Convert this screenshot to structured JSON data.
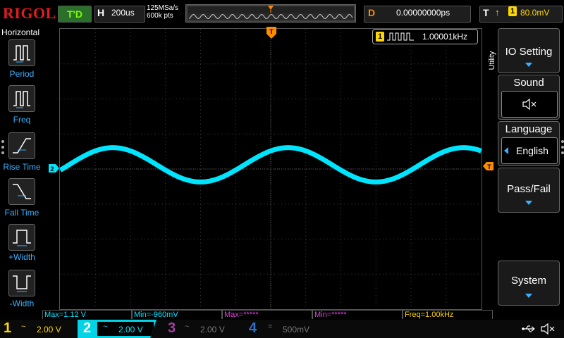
{
  "header": {
    "brand": "RIGOL",
    "run_state": "T'D",
    "horizontal_letter": "H",
    "timebase": "200us",
    "sample_rate": "125MSa/s",
    "memory_depth": "600k pts",
    "delay_letter": "D",
    "delay_value": "0.00000000ps",
    "trigger_letter": "T",
    "trigger_source": "1",
    "trigger_level": "80.0mV"
  },
  "left_panel": {
    "title": "Horizontal",
    "items": [
      {
        "label": "Period"
      },
      {
        "label": "Freq"
      },
      {
        "label": "Rise Time"
      },
      {
        "label": "Fall Time"
      },
      {
        "label": "+Width"
      },
      {
        "label": "-Width"
      }
    ]
  },
  "screen": {
    "channel_marker": "2",
    "trigger_marker": "T",
    "frequency_counter_channel": "1",
    "frequency_counter_value": "1.00001kHz"
  },
  "right_menu": {
    "tab_label": "Utility",
    "io_setting": "IO Setting",
    "sound_title": "Sound",
    "language_title": "Language",
    "language_value": "English",
    "pass_fail": "Pass/Fail",
    "system": "System"
  },
  "measurements": [
    {
      "text": "Max=1.12 V",
      "color": "#00e5ff"
    },
    {
      "text": "Min=-960mV",
      "color": "#00e5ff"
    },
    {
      "text": "Max=*****",
      "color": "#e040e0"
    },
    {
      "text": "Min=*****",
      "color": "#e040e0"
    },
    {
      "text": "Freq=1.00kHz",
      "color": "#ffd700"
    }
  ],
  "channels": [
    {
      "num": "1",
      "coupling": "~",
      "scale": "2.00 V",
      "color": "#ffd700"
    },
    {
      "num": "2",
      "coupling": "~",
      "scale": "2.00 V",
      "color": "#00e5ff"
    },
    {
      "num": "3",
      "coupling": "~",
      "scale": "2.00 V",
      "color": "#a040a0"
    },
    {
      "num": "4",
      "coupling": "=",
      "scale": "500mV",
      "color": "#3070d0"
    }
  ],
  "colors": {
    "trace_ch2": "#00e5ff",
    "trigger": "#ff8c00",
    "accent_blue": "#3ab0ff"
  },
  "icons": [
    "usb-icon",
    "speaker-mute-icon"
  ]
}
